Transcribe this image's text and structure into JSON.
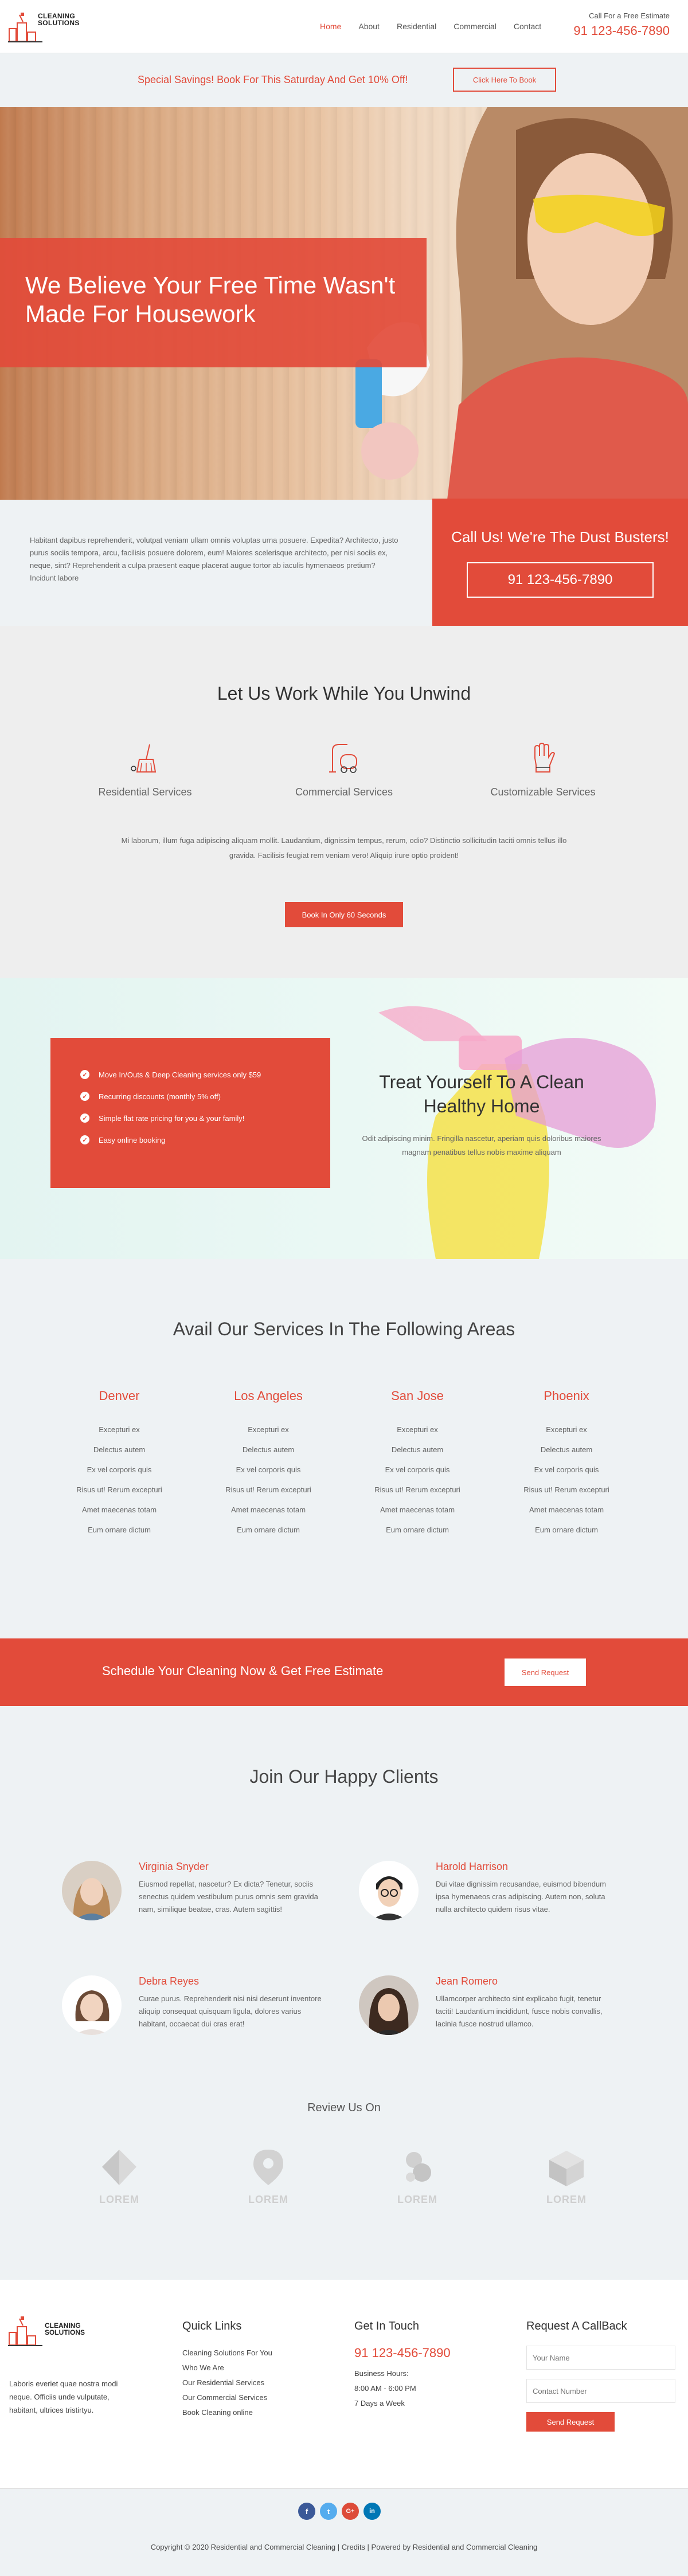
{
  "brand": {
    "line1": "CLEANING",
    "line2": "SOLUTIONS"
  },
  "nav": [
    "Home",
    "About",
    "Residential",
    "Commercial",
    "Contact"
  ],
  "call": {
    "label": "Call For a Free Estimate",
    "phone": "91 123-456-7890"
  },
  "promo": {
    "text": "Special Savings! Book For This Saturday And Get 10% Off!",
    "button": "Click Here To Book"
  },
  "hero": {
    "title": "We Believe Your Free Time Wasn't Made For Housework"
  },
  "about": {
    "text": "Habitant dapibus reprehenderit, volutpat veniam ullam omnis voluptas urna posuere. Expedita? Architecto, justo purus sociis tempora, arcu, facilisis posuere dolorem, eum! Maiores scelerisque architecto, per nisi sociis ex, neque, sint? Reprehenderit a culpa praesent eaque placerat augue tortor ab iaculis hymenaeos pretium? Incidunt labore",
    "call_title": "Call Us! We're The Dust Busters!",
    "phone": "91 123-456-7890"
  },
  "work": {
    "title": "Let Us Work While You Unwind",
    "services": [
      {
        "icon": "broom-icon",
        "label": "Residential Services"
      },
      {
        "icon": "vacuum-icon",
        "label": "Commercial Services"
      },
      {
        "icon": "glove-icon",
        "label": "Customizable Services"
      }
    ],
    "paragraph": "Mi laborum, illum fuga adipiscing aliquam mollit. Laudantium, dignissim tempus, rerum, odio? Distinctio sollicitudin taciti omnis tellus illo gravida. Facilisis feugiat rem veniam vero! Aliquip irure optio proident!",
    "button": "Book In Only 60 Seconds"
  },
  "treat": {
    "items": [
      "Move In/Outs & Deep Cleaning services only $59",
      "Recurring discounts (monthly 5% off)",
      "Simple flat rate pricing for you & your family!",
      "Easy online booking"
    ],
    "title": "Treat Yourself To A Clean Healthy Home",
    "text": "Odit adipiscing minim. Fringilla nascetur, aperiam quis doloribus maiores magnam penatibus tellus nobis maxime aliquam"
  },
  "areas": {
    "title": "Avail Our Services In The Following Areas",
    "cities": [
      {
        "name": "Denver",
        "items": [
          "Excepturi ex",
          "Delectus autem",
          "Ex vel corporis quis",
          "Risus ut! Rerum excepturi",
          "Amet maecenas totam",
          "Eum ornare dictum"
        ]
      },
      {
        "name": "Los Angeles",
        "items": [
          "Excepturi ex",
          "Delectus autem",
          "Ex vel corporis quis",
          "Risus ut! Rerum excepturi",
          "Amet maecenas totam",
          "Eum ornare dictum"
        ]
      },
      {
        "name": "San Jose",
        "items": [
          "Excepturi ex",
          "Delectus autem",
          "Ex vel corporis quis",
          "Risus ut! Rerum excepturi",
          "Amet maecenas totam",
          "Eum ornare dictum"
        ]
      },
      {
        "name": "Phoenix",
        "items": [
          "Excepturi ex",
          "Delectus autem",
          "Ex vel corporis quis",
          "Risus ut! Rerum excepturi",
          "Amet maecenas totam",
          "Eum ornare dictum"
        ]
      }
    ]
  },
  "schedule": {
    "text": "Schedule Your Cleaning Now & Get Free Estimate",
    "button": "Send Request"
  },
  "clients": {
    "title": "Join Our Happy Clients",
    "list": [
      {
        "name": "Virginia Snyder",
        "text": "Eiusmod repellat, nascetur? Ex dicta? Tenetur, sociis senectus quidem vestibulum purus omnis sem gravida nam, similique beatae, cras. Autem sagittis!"
      },
      {
        "name": "Harold Harrison",
        "text": "Dui vitae dignissim recusandae, euismod bibendum ipsa hymenaeos cras adipiscing. Autem non, soluta nulla architecto quidem risus vitae."
      },
      {
        "name": "Debra Reyes",
        "text": "Curae purus. Reprehenderit nisi nisi deserunt inventore aliquip consequat quisquam ligula, dolores varius habitant, occaecat dui cras erat!"
      },
      {
        "name": "Jean Romero",
        "text": "Ullamcorper architecto sint explicabo fugit, tenetur taciti! Laudantium incididunt, fusce nobis convallis, lacinia fusce nostrud ullamco."
      }
    ],
    "review_title": "Review Us On",
    "review_logos": [
      "LOREM",
      "LOREM",
      "LOREM",
      "LOREM"
    ]
  },
  "footer": {
    "about": "Laboris everiet quae nostra modi neque. Officiis unde vulputate, habitant, ultrices tristirtyu.",
    "quick_title": "Quick Links",
    "links": [
      "Cleaning Solutions For You",
      "Who We Are",
      "Our Residential Services",
      "Our Commercial Services",
      "Book Cleaning online"
    ],
    "touch_title": "Get In Touch",
    "phone": "91 123-456-7890",
    "hours_label": "Business Hours:",
    "hours": "8:00 AM - 6:00 PM",
    "days": "7 Days a Week",
    "callback_title": "Request A CallBack",
    "name_placeholder": "Your Name",
    "number_placeholder": "Contact Number",
    "button": "Send Request",
    "social": [
      "f",
      "t",
      "G+",
      "in"
    ],
    "copyright": "Copyright © 2020 Residential and Commercial Cleaning | Credits | Powered by Residential and Commercial Cleaning"
  },
  "colors": {
    "accent": "#e24b3a"
  }
}
